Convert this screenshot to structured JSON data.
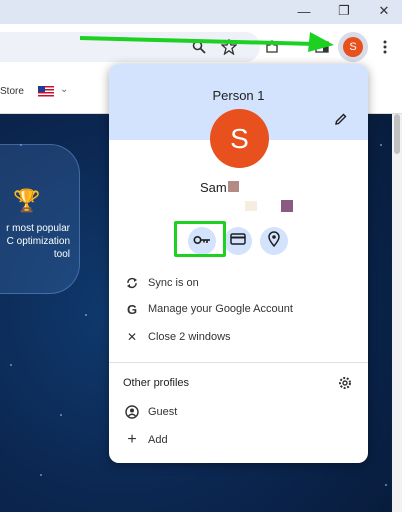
{
  "window": {
    "minimize_glyph": "—",
    "restore_glyph": "❐",
    "close_glyph": "✕"
  },
  "toolbar": {
    "zoom_icon": "zoom-icon",
    "bookmark_icon": "star-icon",
    "extensions_icon": "puzzle-icon",
    "profile_initial": "S",
    "menu_icon": "three-dot-menu-icon"
  },
  "page": {
    "store_label": "Store",
    "promo_text": "r most popular\nC optimization\ntool"
  },
  "profile_popup": {
    "person_label": "Person 1",
    "avatar_initial": "S",
    "user_name": "Sam",
    "avatar_color": "#e8501e",
    "header_color": "#d3e3fd",
    "actions": [
      {
        "name": "passwords",
        "icon": "key-icon"
      },
      {
        "name": "payment-methods",
        "icon": "credit-card-icon"
      },
      {
        "name": "addresses",
        "icon": "location-pin-icon"
      }
    ],
    "menu": {
      "sync": "Sync is on",
      "manage_account": "Manage your Google Account",
      "close_windows": "Close 2 windows"
    },
    "other_profiles": {
      "title": "Other profiles",
      "guest": "Guest",
      "add": "Add"
    }
  },
  "annotation": {
    "arrow_color": "#1dd123",
    "highlight_color": "#1dd123"
  }
}
